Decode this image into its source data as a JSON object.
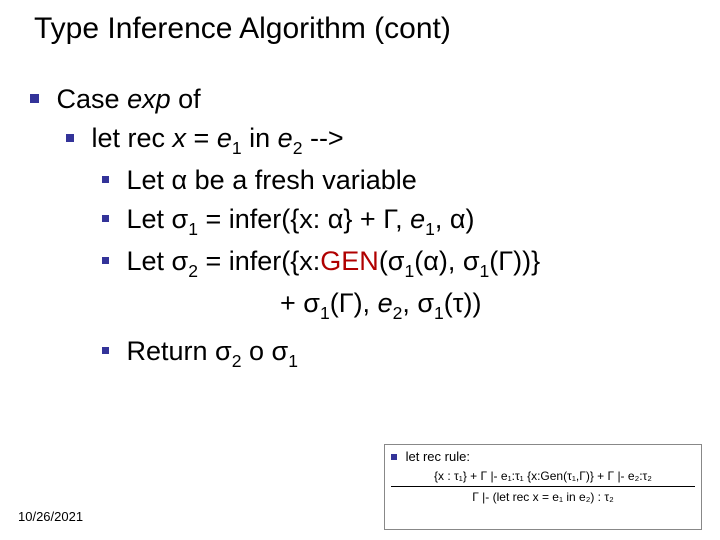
{
  "title": "Type Inference Algorithm (cont)",
  "l1_pre": "Case ",
  "l1_exp": "exp",
  "l1_post": " of",
  "l2_pre": "let rec ",
  "l2_x": "x",
  "l2_eq": " = ",
  "l2_e": "e",
  "l2_s1": "1",
  "l2_in": " in ",
  "l2_s2": "2",
  "l2_arrow": " -->",
  "l3_pre": "Let α be a fresh variable",
  "l4_pre": "Let σ",
  "l4_s1": "1",
  "l4_mid": " = infer({x: α} + Γ, ",
  "l4_e": "e",
  "l4_es": "1",
  "l4_end": ", α)",
  "l5_pre": "Let σ",
  "l5_s2": "2",
  "l5_mid": " = infer({x:",
  "l5_gen": "GEN",
  "l5_post_gen": "(σ",
  "l5_s1a": "1",
  "l5_alpha": "(α), σ",
  "l5_s1b": "1",
  "l5_close": "(Γ))}",
  "l5b_pre": "+ σ",
  "l5b_s1": "1",
  "l5b_after": "(Γ), ",
  "l5b_e": "e",
  "l5b_es": "2",
  "l5b_mid": ", σ",
  "l5b_s1b": "1",
  "l5b_end": "(τ))",
  "l6_pre": "Return σ",
  "l6_s2": "2",
  "l6_mid": " o σ",
  "l6_s1": "1",
  "footer_date": "10/26/2021",
  "rule_label": "let rec rule:",
  "rule_num": "{x : τ₁} + Γ |- e₁:τ₁   {x:Gen(τ₁,Γ)} + Γ |- e₂:τ₂",
  "rule_den": "Γ |- (let rec x = e₁ in e₂) : τ₂"
}
